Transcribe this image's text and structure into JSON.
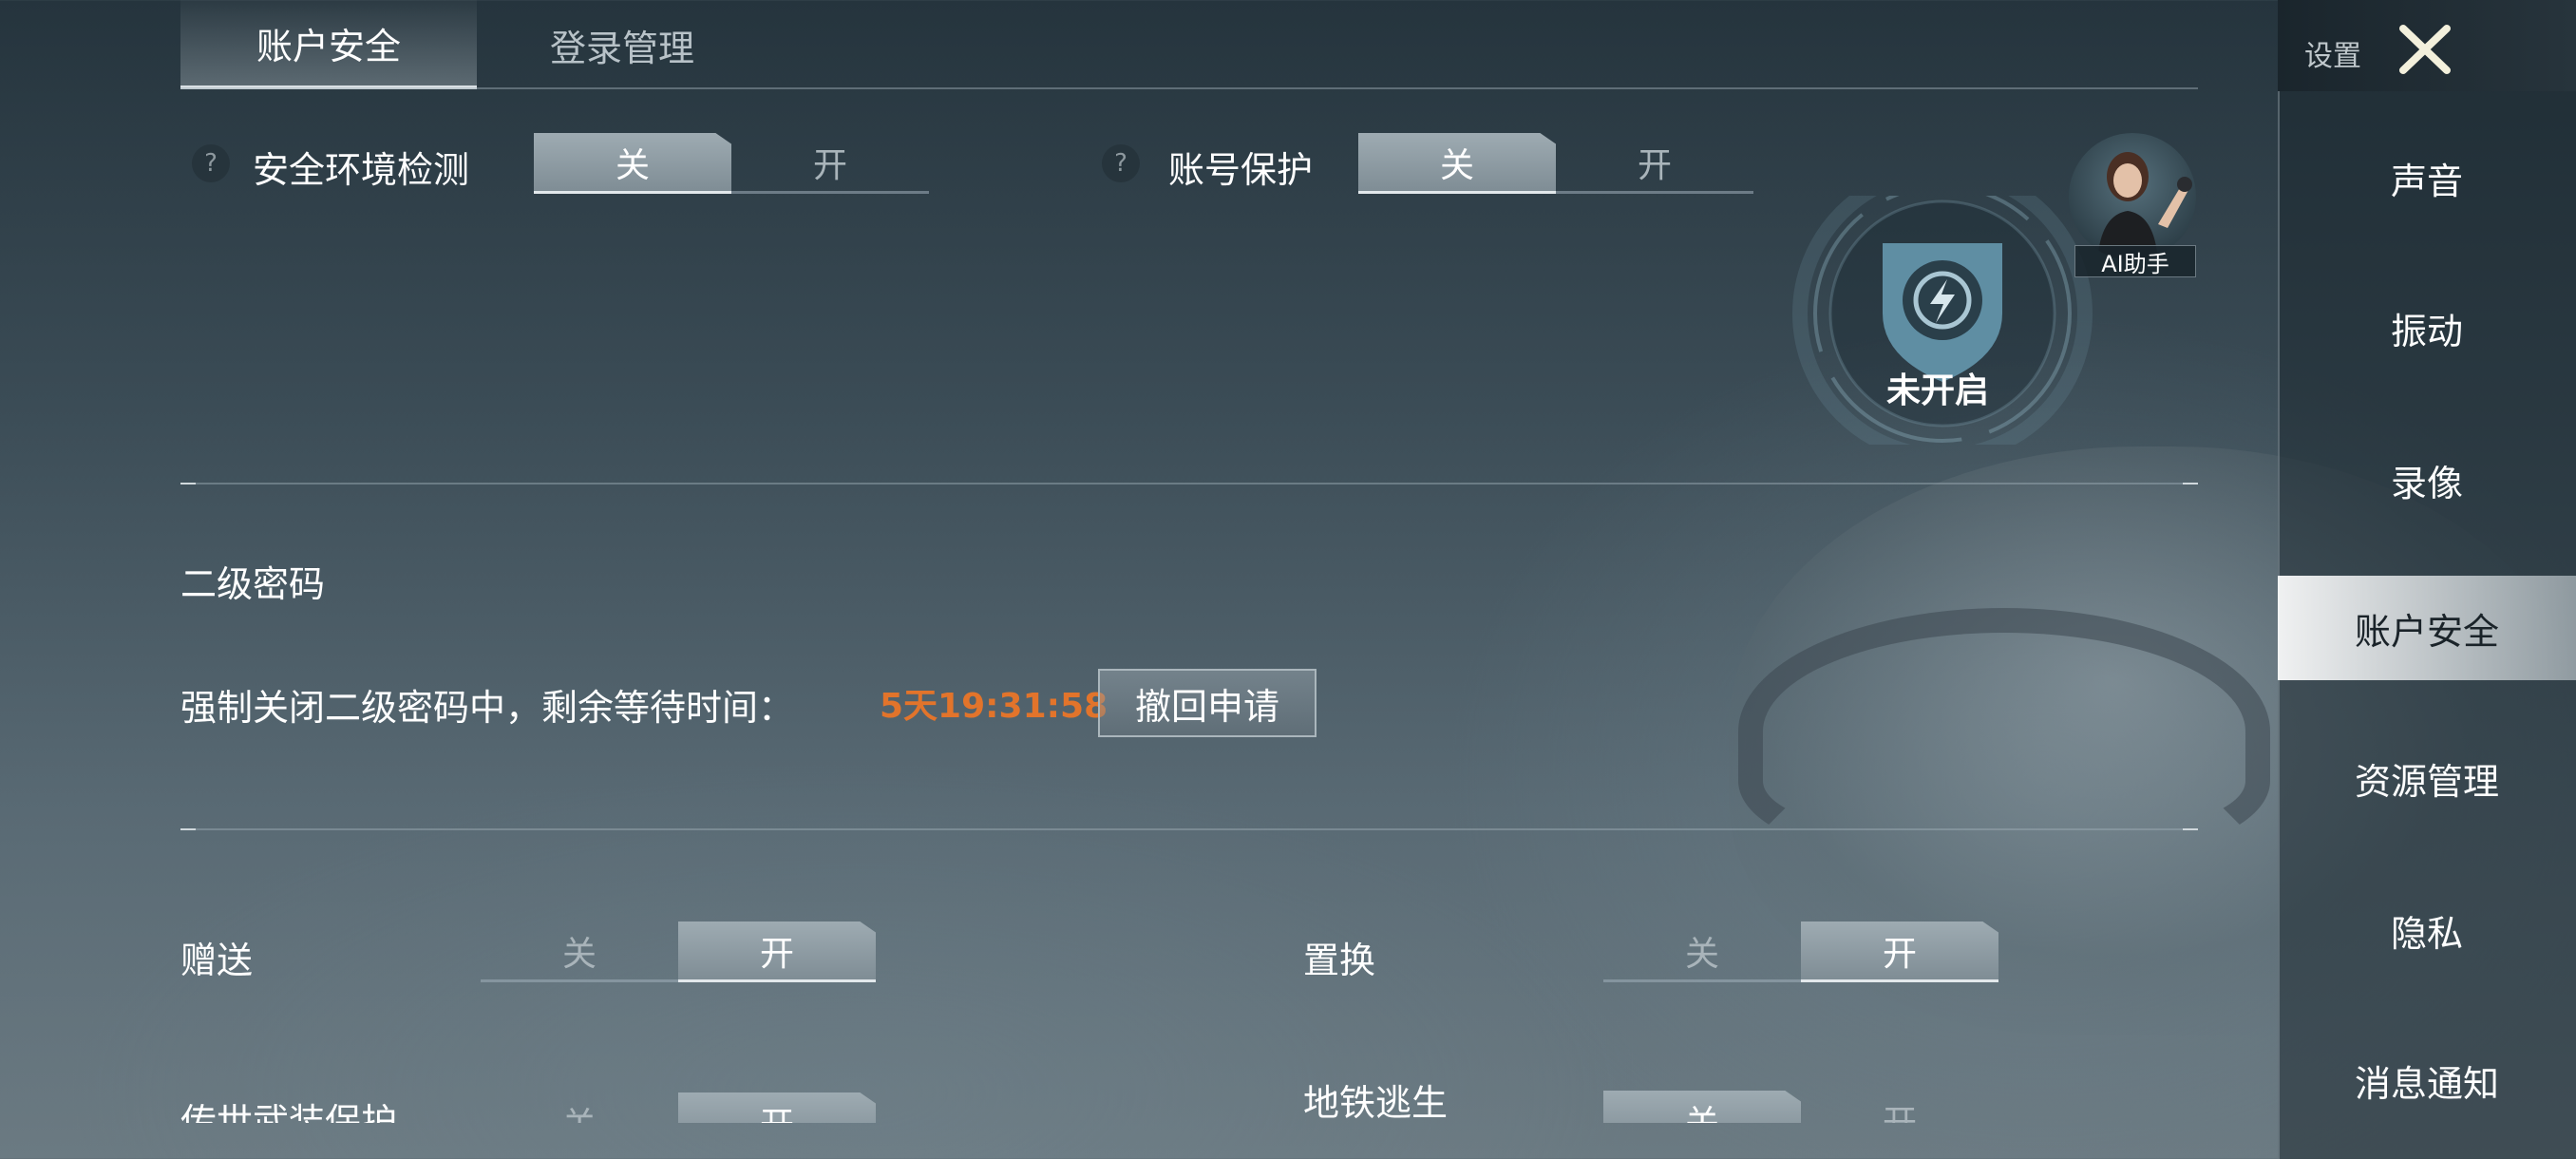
{
  "tabs": [
    {
      "label": "账户安全",
      "active": true
    },
    {
      "label": "登录管理",
      "active": false
    }
  ],
  "top_settings": [
    {
      "help_icon": "?",
      "label": "安全环境检测",
      "off_label": "关",
      "on_label": "开",
      "state": "off"
    },
    {
      "help_icon": "?",
      "label": "账号保护",
      "off_label": "关",
      "on_label": "开",
      "state": "off"
    }
  ],
  "protection_badge": {
    "status": "未开启",
    "icon": "shield-lightning-icon"
  },
  "ai_assistant": {
    "label": "AI助手"
  },
  "secondary_password": {
    "title": "二级密码",
    "message": "强制关闭二级密码中，剩余等待时间：",
    "countdown": "5天19:31:58",
    "button": "撤回申请"
  },
  "trade_settings": [
    {
      "label": "赠送",
      "off_label": "关",
      "on_label": "开",
      "state": "on"
    },
    {
      "label": "置换",
      "off_label": "关",
      "on_label": "开",
      "state": "on"
    },
    {
      "label": "传世武装保护",
      "off_label": "关",
      "on_label": "开",
      "state": "on"
    },
    {
      "label": "地铁逃生",
      "off_label": "关",
      "on_label": "开",
      "state": "off"
    }
  ],
  "sidebar": {
    "title": "设置",
    "close_icon": "close-x-icon",
    "items": [
      {
        "label": "声音",
        "active": false
      },
      {
        "label": "振动",
        "active": false
      },
      {
        "label": "录像",
        "active": false
      },
      {
        "label": "账户安全",
        "active": true
      },
      {
        "label": "资源管理",
        "active": false
      },
      {
        "label": "隐私",
        "active": false
      },
      {
        "label": "消息通知",
        "active": false
      }
    ]
  },
  "colors": {
    "countdown": "#e2742b",
    "toggle_on": "#8f9ca3",
    "active_nav": "#ffffff",
    "emblem": "#5f8ea3"
  }
}
